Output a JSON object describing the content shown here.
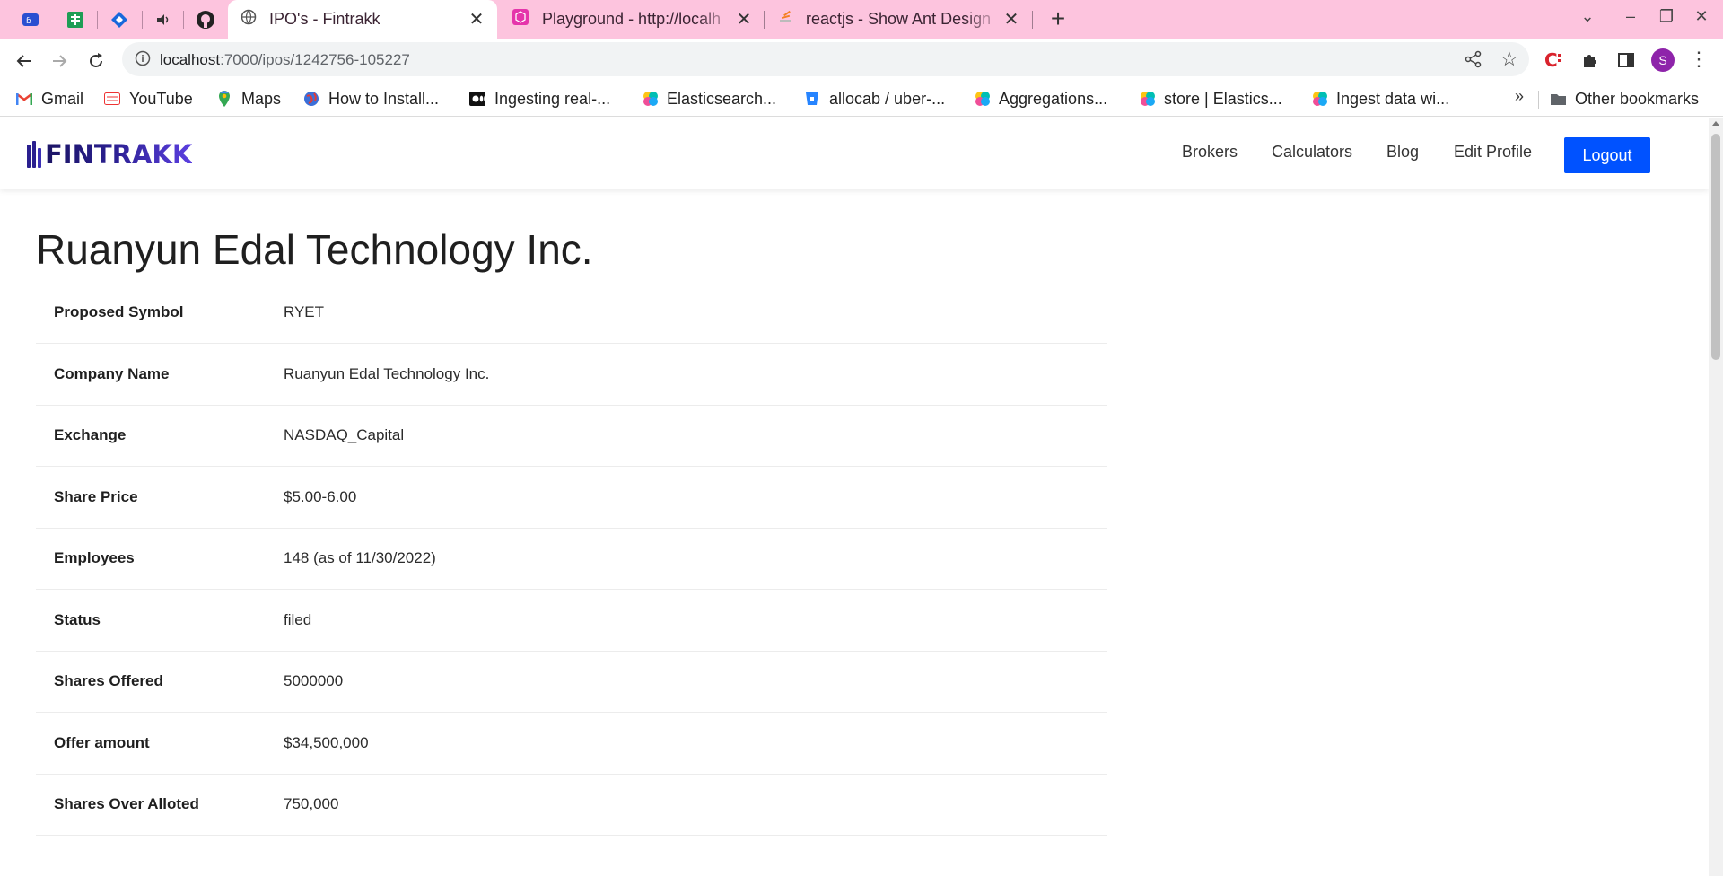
{
  "browser": {
    "tabs": [
      {
        "title": "IPO's - Fintrakk",
        "active": true
      },
      {
        "title": "Playground - http://localh",
        "active": false
      },
      {
        "title": "reactjs - Show Ant Design",
        "active": false
      }
    ],
    "url": {
      "host": "localhost",
      "path": ":7000/ipos/1242756-105227"
    },
    "profile_initial": "S",
    "bookmarks": [
      {
        "label": "Gmail",
        "icon": "gmail-icon"
      },
      {
        "label": "YouTube",
        "icon": "youtube-icon"
      },
      {
        "label": "Maps",
        "icon": "maps-icon"
      },
      {
        "label": "How to Install...",
        "icon": "globe-icon"
      },
      {
        "label": "Ingesting real-...",
        "icon": "medium-icon"
      },
      {
        "label": "Elasticsearch...",
        "icon": "elastic-icon"
      },
      {
        "label": "allocab / uber-...",
        "icon": "bitbucket-icon"
      },
      {
        "label": "Aggregations...",
        "icon": "elastic-icon"
      },
      {
        "label": "store | Elastics...",
        "icon": "elastic-icon"
      },
      {
        "label": "Ingest data wi...",
        "icon": "elastic-icon"
      }
    ],
    "bookmarks_more": "»",
    "other_bookmarks": "Other bookmarks",
    "colors": {
      "tabstrip": "#fdc4de"
    }
  },
  "site": {
    "logo_text": "FINTRAKK",
    "nav": [
      "Brokers",
      "Calculators",
      "Blog",
      "Edit Profile"
    ],
    "logout": "Logout",
    "accent": "#0052ff"
  },
  "ipo": {
    "title": "Ruanyun Edal Technology Inc.",
    "rows": [
      {
        "label": "Proposed Symbol",
        "value": "RYET"
      },
      {
        "label": "Company Name",
        "value": "Ruanyun Edal Technology Inc."
      },
      {
        "label": "Exchange",
        "value": "NASDAQ_Capital"
      },
      {
        "label": "Share Price",
        "value": "$5.00-6.00"
      },
      {
        "label": "Employees",
        "value": "148 (as of 11/30/2022)"
      },
      {
        "label": "Status",
        "value": "filed"
      },
      {
        "label": "Shares Offered",
        "value": "5000000"
      },
      {
        "label": "Offer amount",
        "value": "$34,500,000"
      },
      {
        "label": "Shares Over Alloted",
        "value": "750,000"
      }
    ]
  }
}
